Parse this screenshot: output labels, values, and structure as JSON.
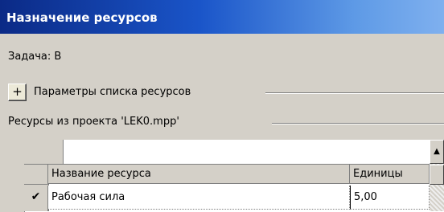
{
  "window": {
    "title": "Назначение ресурсов"
  },
  "task": {
    "label": "Задача: В"
  },
  "parameters": {
    "toggle_icon": "plus-icon",
    "toggle_label": "+",
    "label": "Параметры списка ресурсов"
  },
  "resources": {
    "label": "Ресурсы из проекта 'LEK0.mpp'"
  },
  "grid": {
    "columns": [
      "Название ресурса",
      "Единицы"
    ],
    "rows": [
      {
        "checked_icon": "checkmark-icon",
        "check_glyph": "✔",
        "name": "Рабочая сила",
        "units": "5,00"
      }
    ]
  },
  "scrollbar": {
    "up_glyph": "▲"
  }
}
